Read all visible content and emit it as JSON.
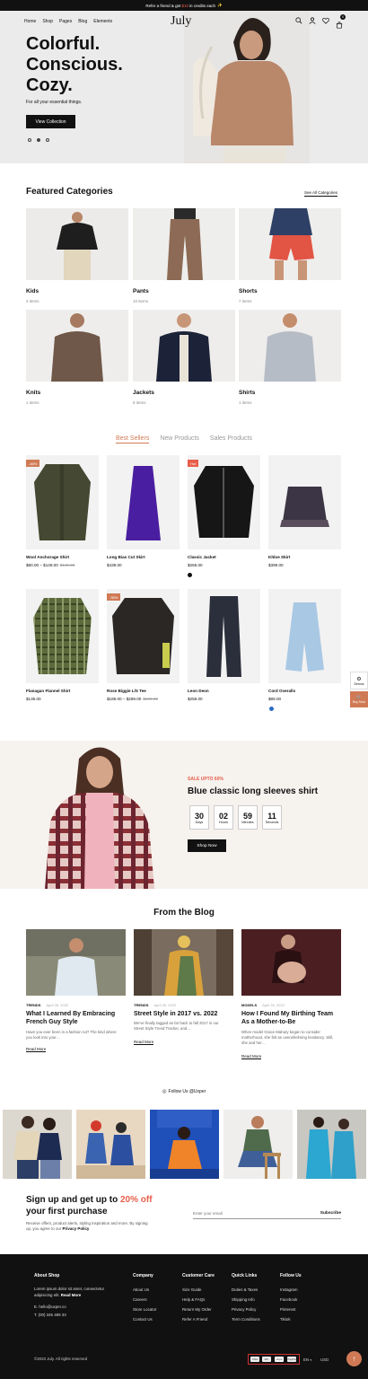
{
  "announcement": {
    "pre": "Refer a friend & get",
    "highlight": "$10",
    "post": "in credits each",
    "emoji": "✨"
  },
  "nav": {
    "items": [
      "Home",
      "Shop",
      "Pages",
      "Blog",
      "Elements"
    ],
    "logo": "July",
    "cart_count": "0"
  },
  "hero": {
    "title_lines": [
      "Colorful.",
      "Conscious.",
      "Cozy."
    ],
    "subtitle": "For all your essential things.",
    "button": "View Collection"
  },
  "categories": {
    "title": "Featured Categories",
    "see_all": "See All Categories",
    "items": [
      {
        "name": "Kids",
        "count": "3 items"
      },
      {
        "name": "Pants",
        "count": "10 items"
      },
      {
        "name": "Shorts",
        "count": "7 items"
      },
      {
        "name": "Knits",
        "count": "1 items"
      },
      {
        "name": "Jackets",
        "count": "8 items"
      },
      {
        "name": "Shirts",
        "count": "1 items"
      }
    ]
  },
  "product_tabs": [
    "Best Sellers",
    "New Products",
    "Sales Products"
  ],
  "products": [
    {
      "name": "Wool Anchorage Shirt",
      "price": "$80.00 – $149.00",
      "old_price": "$149.00",
      "badge": "-46%"
    },
    {
      "name": "Long Bias Cut Skirt",
      "price": "$439.00",
      "old_price": "",
      "badge": ""
    },
    {
      "name": "Classic Jacket",
      "price": "$265.00",
      "old_price": "",
      "badge": "Hot"
    },
    {
      "name": "Khloe Skirt",
      "price": "$399.00",
      "old_price": "",
      "badge": ""
    },
    {
      "name": "Flanagan Flannel Shirt",
      "price": "$135.00",
      "old_price": "",
      "badge": ""
    },
    {
      "name": "Rose Biggie L/S Tee",
      "price": "$189.00 – $289.00",
      "old_price": "$289.00",
      "badge": "-35%"
    },
    {
      "name": "Leon Deon",
      "price": "$259.00",
      "old_price": "",
      "badge": ""
    },
    {
      "name": "Cord Overalls",
      "price": "$89.00",
      "old_price": "",
      "badge": ""
    }
  ],
  "side_widgets": {
    "demos": "Demos",
    "buy_now": "Buy Now"
  },
  "promo": {
    "tag": "SALE UPTO 60%",
    "title": "Blue classic long sleeves shirt",
    "countdown": [
      {
        "value": "30",
        "label": "Days"
      },
      {
        "value": "02",
        "label": "Hours"
      },
      {
        "value": "59",
        "label": "Minutes"
      },
      {
        "value": "11",
        "label": "Seconds"
      }
    ],
    "button": "Shop Now"
  },
  "blog": {
    "title": "From the Blog",
    "posts": [
      {
        "category": "TRENDS",
        "date": "April 26, 2022",
        "title": "What I Learned By Embracing French Guy Style",
        "excerpt": "Have you ever been in a fashion rut? The kind where you look into your…",
        "more": "Read More"
      },
      {
        "category": "TRENDS",
        "date": "April 26, 2022",
        "title": "Street Style in 2017 vs. 2022",
        "excerpt": "We've finally tagged as far back to fall 2017 in our Street Style Trend Tracker, and…",
        "more": "Read More"
      },
      {
        "category": "MODELS",
        "date": "April 26, 2022",
        "title": "How I Found My Birthing Team As a Mother-to-Be",
        "excerpt": "When model Grace Mahary began to consider motherhood, she felt an overwhelming hesitancy. Still, she and her…",
        "more": "Read More"
      }
    ]
  },
  "instagram": {
    "label": "Follow Us @Uxper"
  },
  "newsletter": {
    "title_pre": "Sign up and get up to",
    "title_highlight": "20% off",
    "title_post": "your first purchase",
    "desc": "Receive offers, product alerts, styling inspiration and more. By signing up, you agree to our",
    "desc_link": "Privacy Policy",
    "placeholder": "Enter your email",
    "button": "Subscribe"
  },
  "footer": {
    "about_title": "About Shop",
    "about_text": "Lorem ipsum dolor sit amet, consectetur adipisicing elit.",
    "about_more": "Read More",
    "email": "E. hello@uxper.co",
    "phone": "T. (00) 345 489 33",
    "columns": [
      {
        "title": "Company",
        "links": [
          "About Us",
          "Careers",
          "Store Locator",
          "Contact Us"
        ]
      },
      {
        "title": "Customer Care",
        "links": [
          "Size Guide",
          "Help & FAQs",
          "Return My Order",
          "Refer A Friend"
        ]
      },
      {
        "title": "Quick Links",
        "links": [
          "Duties & Taxes",
          "Shipping Info",
          "Privacy Policy",
          "Term Conditions"
        ]
      },
      {
        "title": "Follow Us",
        "links": [
          "Instagram",
          "Facebook",
          "Pinterest",
          "Tiktok"
        ]
      }
    ],
    "copyright": "©2023 July. All rights reserved",
    "payments": [
      "VISA",
      "MC",
      "stripe",
      "PayPal"
    ],
    "language": "EN",
    "currency": "USD"
  },
  "colors": {
    "accent": "#d07a55",
    "sale_red": "#e85d4a",
    "dark": "#111111"
  }
}
